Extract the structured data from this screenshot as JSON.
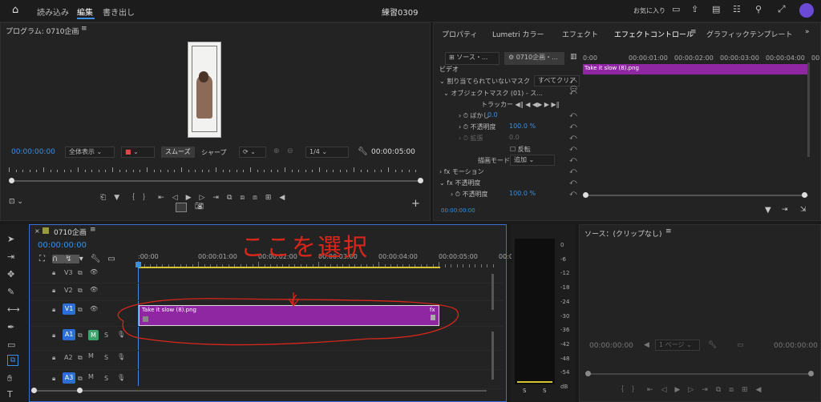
{
  "topbar": {
    "home_icon": "home-icon",
    "menus": [
      "読み込み",
      "編集",
      "書き出し"
    ],
    "project_title": "練習0309",
    "favorites": "お気に入り"
  },
  "program": {
    "title": "プログラム: 0710企画",
    "timecode": "00:00:00:00",
    "fit": "全体表示",
    "smooth": "スムーズ",
    "sharp": "シャープ",
    "resolution": "1/4",
    "duration": "00:00:05:00"
  },
  "effects_tabs": [
    "プロパティ",
    "Lumetri カラー",
    "エフェクト",
    "エフェクトコントロール",
    "グラフィックテンプレート"
  ],
  "ec": {
    "source_tab": "ソース・...",
    "seq_tab": "0710企画・...",
    "video": "ビデオ",
    "mask_unassigned": "割り当てられていないマスク",
    "clear_all": "すべてクリア",
    "object_mask": "オブジェクトマスク (01) - ス...",
    "tracker": "トラッカー",
    "feather": "ぼかし",
    "feather_val": "0.0",
    "opacity": "不透明度",
    "opacity_val": "100.0 %",
    "expansion": "拡張",
    "expansion_val": "0.0",
    "invert": "反転",
    "blend_mode": "描画モード",
    "blend_val": "追加",
    "motion": "モーション",
    "opacity_fx": "不透明度",
    "opacity2": "不透明度",
    "opacity2_val": "100.0 %",
    "ruler": [
      "0:00",
      "00:00:01:00",
      "00:00:02:00",
      "00:00:03:00",
      "00:00:04:00",
      "00"
    ],
    "clip_name": "Take it slow (8).png",
    "timecode": "00:00:00:00"
  },
  "timeline": {
    "tab": "0710企画",
    "timecode": "00:00:00:00",
    "ruler": [
      ":00:00",
      "00:00:01:00",
      "00:00:02:00",
      "00:00:03:00",
      "00:00:04:00",
      "00:00:05:00",
      "00:0"
    ],
    "tracks": [
      "V3",
      "V2",
      "V1",
      "A1",
      "A2",
      "A3"
    ],
    "clip_name": "Take it slow (8).png",
    "mute": "M",
    "solo": "S",
    "fx": "fx"
  },
  "annotation": {
    "text": "ここを選択"
  },
  "meter": {
    "labels": [
      "0",
      "-6",
      "-12",
      "-18",
      "-24",
      "-30",
      "-36",
      "-42",
      "-48",
      "-54",
      "dB"
    ],
    "s": "S"
  },
  "source": {
    "title": "ソース：(クリップなし)",
    "timecode": "00:00:00:00",
    "page": "1 ページ",
    "right_timecode": "00:00:00:00"
  },
  "colors": {
    "accent": "#3b8fe0",
    "clip": "#8f27a3",
    "track_chip": "#2d6ed4",
    "annotation": "#d8261b"
  }
}
